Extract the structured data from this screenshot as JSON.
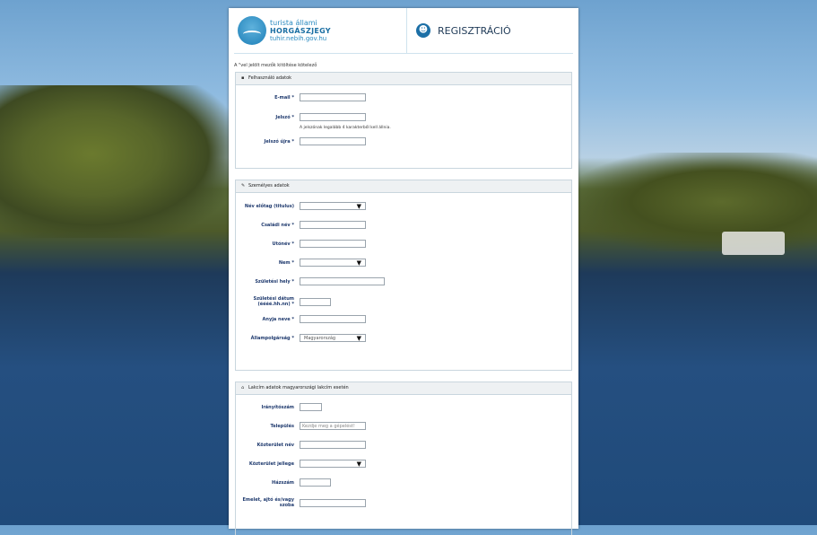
{
  "logo": {
    "line1": "turista állami",
    "line2": "HORGÁSZJEGY",
    "line3": "tuhir.nebih.gov.hu"
  },
  "header": {
    "title": "REGISZTRÁCIÓ"
  },
  "note": "A \"vel jelölt mezők kitöltése kötelező",
  "sections": {
    "user": {
      "title": "Felhasználó adatok",
      "email_label": "E-mail *",
      "password_label": "Jelszó *",
      "password_hint": "A jelszónak legalább 4 karakterből kell állnia.",
      "password_again_label": "Jelszó újra *"
    },
    "personal": {
      "title": "Személyes adatok",
      "prefix_label": "Név előtag (titulus)",
      "family_label": "Családi név *",
      "given_label": "Utónév *",
      "gender_label": "Nem *",
      "birthplace_label": "Születési hely *",
      "birthdate_label": "Születési dátum (éééé.hh.nn) *",
      "mother_label": "Anyja neve *",
      "citizenship_label": "Állampolgárság *",
      "citizenship_value": "Magyarország"
    },
    "address": {
      "title": "Lakcím adatok magyarországi lakcím esetén",
      "zip_label": "Irányítószám",
      "city_label": "Település",
      "city_placeholder": "Kezdje meg a gépelést!",
      "street_label": "Közterület név",
      "street_type_label": "Közterület jellege",
      "house_label": "Házszám",
      "floor_label": "Emelet, ajtó és/vagy szoba"
    }
  }
}
